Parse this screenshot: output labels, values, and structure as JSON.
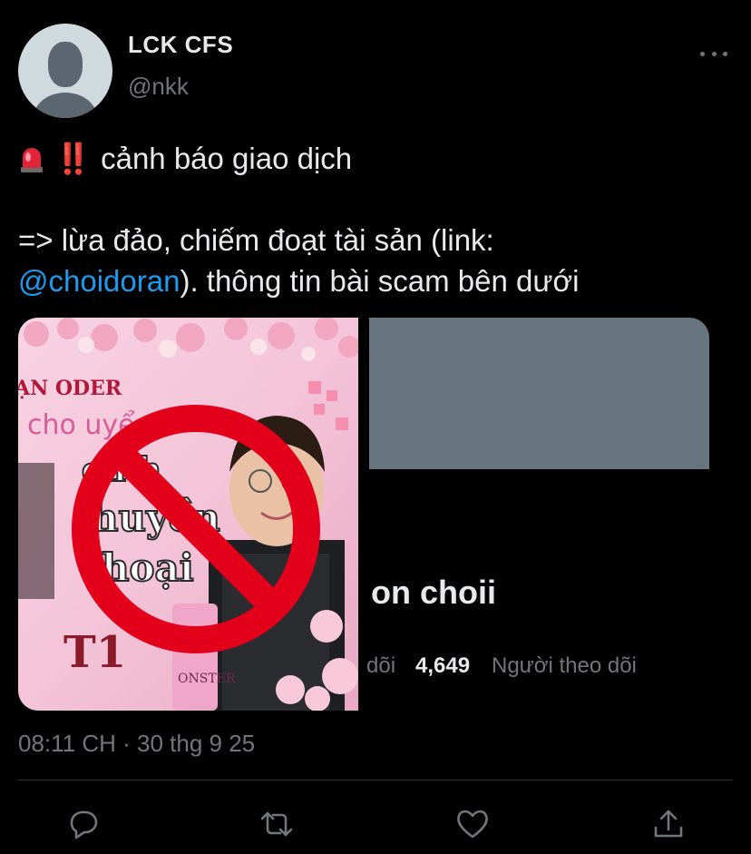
{
  "author": {
    "display_name": "LCK CFS",
    "handle": "@nkk",
    "avatar_icon": "default-avatar-icon"
  },
  "more_icon": "more-options-icon",
  "tweet": {
    "line1_emoji": [
      "police-siren-icon",
      "double-exclamation-icon"
    ],
    "line1_bang": "‼️",
    "line1_text": "cảnh báo giao dịch",
    "line2_text": "=> lừa đảo, chiếm đoạt tài sản (link:",
    "line3_mention": "@choidoran",
    "line3_text": "). thông tin bài scam bên dưới"
  },
  "media": {
    "left_image": "prohibited-sign-over-photo",
    "profile_card": {
      "name_fragment": "on choii",
      "following_fragment": "dõi",
      "followers_count": "4,649",
      "followers_label": "Người theo dõi"
    }
  },
  "timestamp": "08:11 CH · 30 thg 9 25",
  "actions": [
    {
      "name": "reply-icon"
    },
    {
      "name": "retweet-icon"
    },
    {
      "name": "like-icon"
    },
    {
      "name": "share-icon"
    }
  ],
  "colors": {
    "background": "#000000",
    "text": "#e7e9ea",
    "secondary": "#71767b",
    "mention": "#1d9bf0",
    "prohibit_red": "#e3001b",
    "banner": "#66757f"
  }
}
